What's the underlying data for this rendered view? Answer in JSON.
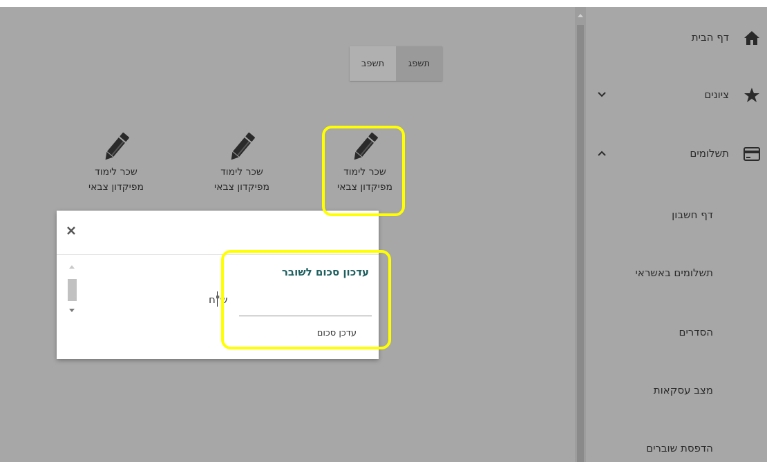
{
  "sidebar": {
    "items": [
      {
        "label": "דף הבית",
        "icon": "home-icon"
      },
      {
        "label": "ציונים",
        "icon": "star-icon",
        "chevron": "chevron-down-icon"
      },
      {
        "label": "תשלומים",
        "icon": "credit-card-icon",
        "chevron": "chevron-up-icon"
      }
    ],
    "sub_items": [
      {
        "label": "דף חשבון"
      },
      {
        "label": "תשלומים באשראי"
      },
      {
        "label": "הסדרים"
      },
      {
        "label": "מצב עסקאות"
      },
      {
        "label": "הדפסת שוברים"
      }
    ]
  },
  "year_toggle": {
    "active": "תשפג",
    "inactive": "תשפב"
  },
  "documents": [
    {
      "line1": "שכר לימוד",
      "line2": "מפיקדון צבאי",
      "icon": "pencil-icon"
    },
    {
      "line1": "שכר לימוד",
      "line2": "מפיקדון צבאי",
      "icon": "pencil-icon"
    },
    {
      "line1": "שכר לימוד",
      "line2": "מפיקדון צבאי",
      "icon": "pencil-icon"
    }
  ],
  "modal": {
    "close_icon": "close-icon",
    "title": "עדכון סכום לשובר",
    "amount_value": "",
    "currency": "ש\"ח",
    "update_label": "עדכן סכום"
  },
  "colors": {
    "background": "#a7a7a7",
    "highlight": "#ffff00",
    "modal_title": "#1f5f5f"
  }
}
